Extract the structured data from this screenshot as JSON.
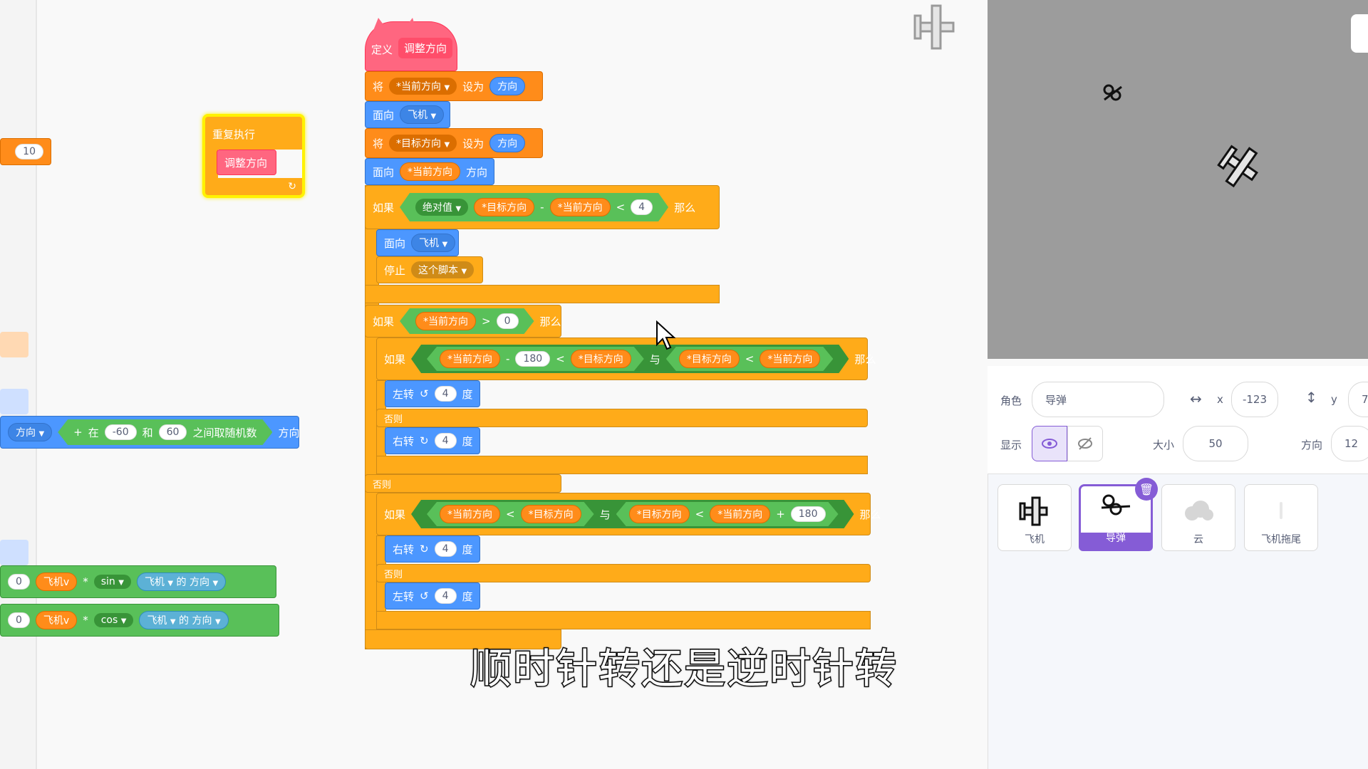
{
  "colors": {
    "events": "#ffab19",
    "motion": "#4c97ff",
    "variables": "#ff8c1a",
    "operators": "#59c059",
    "myblocks": "#ff6680",
    "stage": "#9c9c9c",
    "selected": "#855cd6"
  },
  "left_fragments": {
    "frag_top_num": "10",
    "frag_dir": "方向",
    "frag_plus": "+",
    "frag_in": "在",
    "frag_n1": "-60",
    "frag_and": "和",
    "frag_n2": "60",
    "frag_rand": "之间取随机数",
    "frag_dir2": "方向",
    "frag_zero1": "0",
    "frag_zero2": "0",
    "frag_jiv1": "飞机v",
    "frag_times1": "*",
    "frag_sin": "sin",
    "frag_plane1": "飞机",
    "frag_of1": "的",
    "frag_dirv1": "方向",
    "frag_jiv2": "飞机v",
    "frag_times2": "*",
    "frag_cos": "cos",
    "frag_plane2": "飞机",
    "frag_of2": "的",
    "frag_dirv2": "方向",
    "frag_zero0": "0"
  },
  "forever": {
    "label": "重复执行",
    "inner": "调整方向",
    "arrow": "↻"
  },
  "script": {
    "define": "定义",
    "define_name": "调整方向",
    "set1_a": "将",
    "set1_var": "*当前方向",
    "set1_b": "设为",
    "set1_val": "方向",
    "point1_a": "面向",
    "point1_val": "飞机",
    "set2_a": "将",
    "set2_var": "*目标方向",
    "set2_b": "设为",
    "set2_val": "方向",
    "point2_a": "面向",
    "point2_var": "*当前方向",
    "point2_b": "方向",
    "if1": "如果",
    "abs": "绝对值",
    "t1": "*目标方向",
    "minus1": "-",
    "c1": "*当前方向",
    "lt1": "<",
    "n4": "4",
    "then1": "那么",
    "point3_a": "面向",
    "point3_val": "飞机",
    "stop_a": "停止",
    "stop_val": "这个脚本",
    "if2": "如果",
    "cur2": "*当前方向",
    "gt2": ">",
    "zero2": "0",
    "then2": "那么",
    "if3": "如果",
    "cur3": "*当前方向",
    "minus3": "-",
    "n180a": "180",
    "lt3": "<",
    "tgt3": "*目标方向",
    "and3": "与",
    "tgt3b": "*目标方向",
    "lt3b": "<",
    "cur3b": "*当前方向",
    "then3": "那么",
    "left1_a": "左转",
    "left1_n": "4",
    "left1_b": "度",
    "else1": "否则",
    "right1_a": "右转",
    "right1_n": "4",
    "right1_b": "度",
    "else2": "否则",
    "if4": "如果",
    "cur4": "*当前方向",
    "lt4": "<",
    "tgt4": "*目标方向",
    "and4": "与",
    "tgt4b": "*目标方向",
    "lt4b": "<",
    "cur4b": "*当前方向",
    "plus4": "+",
    "n180b": "180",
    "then4": "那么",
    "right2_a": "右转",
    "right2_n": "4",
    "right2_b": "度",
    "else3": "否则",
    "left2_a": "左转",
    "left2_n": "4",
    "left2_b": "度"
  },
  "sprite_info": {
    "sprite_label": "角色",
    "sprite_name": "导弹",
    "x_label": "x",
    "x_value": "-123",
    "y_label": "y",
    "y_value": "7",
    "show_label": "显示",
    "size_label": "大小",
    "size_value": "50",
    "dir_label": "方向",
    "dir_value": "12"
  },
  "sprites": [
    {
      "name": "飞机",
      "icon": "plane-icon"
    },
    {
      "name": "导弹",
      "icon": "missile-icon"
    },
    {
      "name": "云",
      "icon": "cloud-icon"
    },
    {
      "name": "飞机拖尾",
      "icon": "trail-icon"
    }
  ],
  "subtitle": "顺时针转还是逆时针转"
}
